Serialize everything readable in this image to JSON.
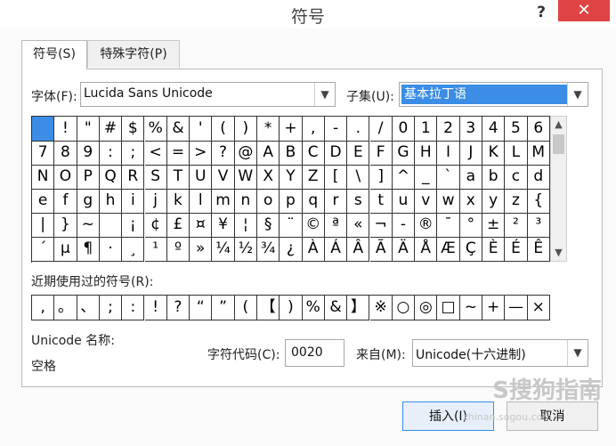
{
  "window": {
    "title": "符号",
    "help": "?",
    "close": "✕"
  },
  "tabs": [
    {
      "label": "符号(S)"
    },
    {
      "label": "特殊字符(P)"
    }
  ],
  "font": {
    "label": "字体(F):",
    "value": "Lucida Sans Unicode"
  },
  "subset": {
    "label": "子集(U):",
    "value": "基本拉丁语"
  },
  "symbol_rows": [
    [
      " ",
      "!",
      "\"",
      "#",
      "$",
      "%",
      "&",
      "'",
      "(",
      ")",
      "*",
      "+",
      ",",
      "-",
      ".",
      "/",
      "0",
      "1",
      "2",
      "3",
      "4",
      "5",
      "6"
    ],
    [
      "7",
      "8",
      "9",
      ":",
      ";",
      "<",
      "=",
      ">",
      "?",
      "@",
      "A",
      "B",
      "C",
      "D",
      "E",
      "F",
      "G",
      "H",
      "I",
      "J",
      "K",
      "L",
      "M"
    ],
    [
      "N",
      "O",
      "P",
      "Q",
      "R",
      "S",
      "T",
      "U",
      "V",
      "W",
      "X",
      "Y",
      "Z",
      "[",
      "\\",
      "]",
      "^",
      "_",
      "`",
      "a",
      "b",
      "c",
      "d"
    ],
    [
      "e",
      "f",
      "g",
      "h",
      "i",
      "j",
      "k",
      "l",
      "m",
      "n",
      "o",
      "p",
      "q",
      "r",
      "s",
      "t",
      "u",
      "v",
      "w",
      "x",
      "y",
      "z",
      "{"
    ],
    [
      "|",
      "}",
      "~",
      " ",
      "¡",
      "¢",
      "£",
      "¤",
      "¥",
      "¦",
      "§",
      "¨",
      "©",
      "ª",
      "«",
      "¬",
      "-",
      "®",
      "¯",
      "°",
      "±",
      "²",
      "³"
    ],
    [
      "´",
      "µ",
      "¶",
      "·",
      "¸",
      "¹",
      "º",
      "»",
      "¼",
      "½",
      "¾",
      "¿",
      "À",
      "Á",
      "Â",
      "Ã",
      "Ä",
      "Å",
      "Æ",
      "Ç",
      "È",
      "É",
      "Ê"
    ]
  ],
  "recent": {
    "label": "近期使用过的符号(R):",
    "symbols": [
      ",",
      "。",
      "、",
      ";",
      ":",
      "!",
      "?",
      "“",
      "”",
      "(",
      "【",
      ")",
      "%",
      "&",
      "】",
      "※",
      "○",
      "◎",
      "□",
      "~",
      "+",
      "—",
      "×"
    ]
  },
  "unicode_name": {
    "label": "Unicode 名称:",
    "value": "空格"
  },
  "char_code": {
    "label": "字符代码(C):",
    "value": "0020"
  },
  "from": {
    "label": "来自(M):",
    "value": "Unicode(十六进制)"
  },
  "buttons": {
    "insert": "插入(I)",
    "cancel": "取消"
  },
  "watermark": {
    "text": "S搜狗指南",
    "url": "zhinan.sogou.com"
  },
  "colors": {
    "selection": "#3b8de5",
    "close": "#e04343"
  }
}
